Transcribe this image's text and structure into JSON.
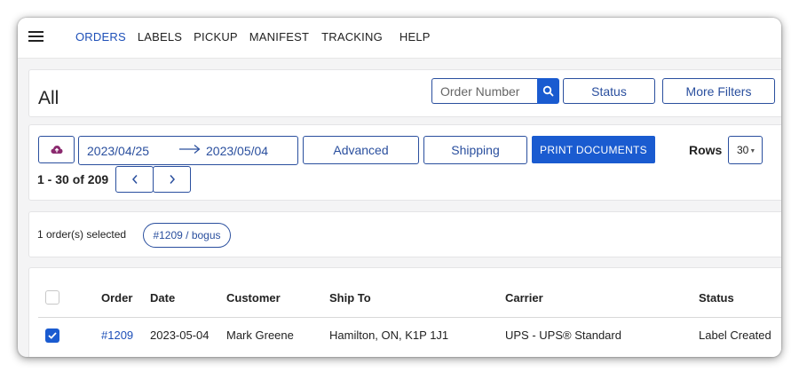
{
  "nav": {
    "items": [
      {
        "label": "ORDERS",
        "active": true
      },
      {
        "label": "LABELS"
      },
      {
        "label": "PICKUP"
      },
      {
        "label": "MANIFEST"
      },
      {
        "label": "TRACKING"
      },
      {
        "label": "HELP"
      }
    ]
  },
  "header": {
    "title": "All",
    "search_placeholder": "Order Number",
    "status_label": "Status",
    "more_filters_label": "More Filters"
  },
  "toolbar": {
    "date_from": "2023/04/25",
    "date_to": "2023/05/04",
    "advanced_label": "Advanced",
    "shipping_label": "Shipping",
    "print_label": "PRINT DOCUMENTS",
    "rows_label": "Rows",
    "rows_value": "30",
    "range_text": "1 - 30 of 209",
    "prev_symbol": "‹",
    "next_symbol": "›"
  },
  "selection": {
    "text": "1 order(s) selected",
    "chip": "#1209 / bogus"
  },
  "table": {
    "columns": [
      "Order",
      "Date",
      "Customer",
      "Ship To",
      "Carrier",
      "Status"
    ],
    "rows": [
      {
        "checked": true,
        "order": "#1209",
        "date": "2023-05-04",
        "customer": "Mark Greene",
        "ship_to": "Hamilton, ON, K1P 1J1",
        "carrier": "UPS - UPS® Standard",
        "status": "Label Created"
      }
    ]
  },
  "colors": {
    "accent": "#1a5bd0",
    "link": "#1d4fb8",
    "border": "#2a4f9e",
    "upload_icon": "#8b2a6f"
  },
  "icons": [
    "menu-icon",
    "search-icon",
    "cloud-upload-icon",
    "arrow-right-icon",
    "chevron-left-icon",
    "chevron-right-icon",
    "checkbox-icon",
    "checkmark-icon"
  ]
}
